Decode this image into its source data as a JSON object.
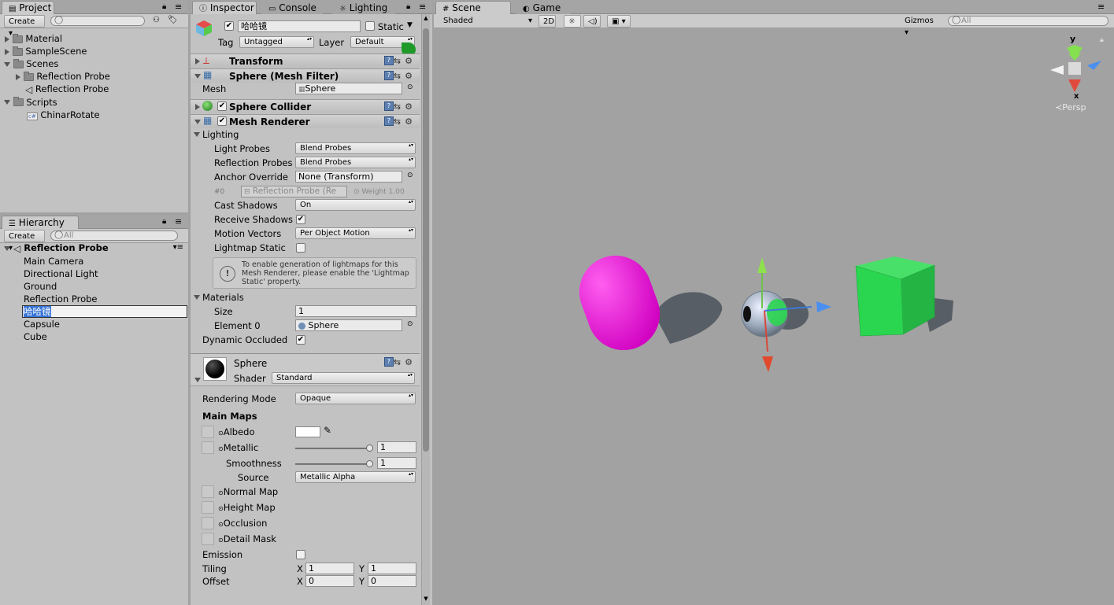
{
  "project": {
    "tab": "Project",
    "create": "Create",
    "items": [
      {
        "label": "Material",
        "indent": 0,
        "kind": "folder",
        "expanded": false
      },
      {
        "label": "SampleScene",
        "indent": 0,
        "kind": "folder",
        "expanded": false
      },
      {
        "label": "Scenes",
        "indent": 0,
        "kind": "folder",
        "expanded": true
      },
      {
        "label": "Reflection Probe",
        "indent": 1,
        "kind": "folder",
        "expanded": false
      },
      {
        "label": "Reflection Probe",
        "indent": 1,
        "kind": "scene"
      },
      {
        "label": "Scripts",
        "indent": 0,
        "kind": "folder",
        "expanded": true
      },
      {
        "label": "ChinarRotate",
        "indent": 1,
        "kind": "script"
      }
    ]
  },
  "hierarchy": {
    "tab": "Hierarchy",
    "create": "Create",
    "search_placeholder": "All",
    "scene": "Reflection Probe",
    "items": [
      "Main Camera",
      "Directional Light",
      "Ground",
      "Reflection Probe",
      "哈哈镜",
      "Capsule",
      "Cube"
    ],
    "selected_index": 4
  },
  "inspector": {
    "tabs": [
      "Inspector",
      "Console",
      "Lighting"
    ],
    "object_name": "哈哈镜",
    "static_label": "Static",
    "tag_label": "Tag",
    "tag_value": "Untagged",
    "layer_label": "Layer",
    "layer_value": "Default",
    "components": {
      "transform": "Transform",
      "mesh_filter": "Sphere (Mesh Filter)",
      "mesh_label": "Mesh",
      "mesh_value": "Sphere",
      "collider": "Sphere Collider",
      "renderer": "Mesh Renderer"
    },
    "lighting": {
      "section": "Lighting",
      "light_probes_label": "Light Probes",
      "light_probes": "Blend Probes",
      "reflection_probes_label": "Reflection Probes",
      "reflection_probes": "Blend Probes",
      "anchor_label": "Anchor Override",
      "anchor_value": "None (Transform)",
      "probe_index": "#0",
      "probe_ref": "Reflection Probe (Re",
      "probe_weight": "Weight 1.00",
      "cast_shadows_label": "Cast Shadows",
      "cast_shadows": "On",
      "receive_shadows_label": "Receive Shadows",
      "motion_vectors_label": "Motion Vectors",
      "motion_vectors": "Per Object Motion",
      "lightmap_static_label": "Lightmap Static",
      "help_text": "To enable generation of lightmaps for this Mesh Renderer, please enable the 'Lightmap Static' property."
    },
    "materials": {
      "section": "Materials",
      "size_label": "Size",
      "size": "1",
      "element_label": "Element 0",
      "element_value": "Sphere",
      "dynamic_occluded_label": "Dynamic Occluded"
    },
    "material": {
      "name": "Sphere",
      "shader_label": "Shader",
      "shader": "Standard",
      "rendering_mode_label": "Rendering Mode",
      "rendering_mode": "Opaque",
      "main_maps": "Main Maps",
      "albedo": "Albedo",
      "metallic": "Metallic",
      "metallic_value": "1",
      "smoothness": "Smoothness",
      "smoothness_value": "1",
      "source_label": "Source",
      "source": "Metallic Alpha",
      "normal_map": "Normal Map",
      "height_map": "Height Map",
      "occlusion": "Occlusion",
      "detail_mask": "Detail Mask",
      "emission": "Emission",
      "tiling_label": "Tiling",
      "tiling_x": "1",
      "tiling_y": "1",
      "offset_label": "Offset",
      "offset_x": "0",
      "offset_y": "0",
      "x": "X",
      "y": "Y"
    }
  },
  "scene": {
    "tabs": [
      "Scene",
      "Game"
    ],
    "shading": "Shaded",
    "mode_2d": "2D",
    "gizmos": "Gizmos",
    "search_placeholder": "All",
    "axis_y": "y",
    "axis_x": "x",
    "persp": "Persp",
    "colors": {
      "capsule": "#ff30e0",
      "cube": "#2ad650",
      "background": "#a2a2a2"
    }
  }
}
